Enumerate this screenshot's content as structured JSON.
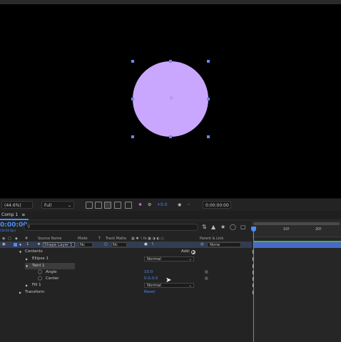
{
  "viewer": {
    "shape_fill": "#caa7ff",
    "handle_color": "#6b86ff"
  },
  "viewer_toolbar": {
    "magnification": "(44.6%)",
    "resolution": "Full",
    "exposure": "+0.0",
    "current_time": "0:00:00:00"
  },
  "timeline_panel": {
    "tab_title": "Comp 1",
    "timecode": "0:00:00",
    "fps_info": "(30.00 fps)",
    "search_placeholder": "",
    "columns": {
      "hash": "#",
      "source_name": "Source Name",
      "mode": "Mode",
      "t": "T",
      "track_matte": "Track Matte",
      "parent": "Parent & Link"
    },
    "layer": {
      "index": "1",
      "name": "Shape Layer 1",
      "mode": "Nc",
      "matte": "Nc",
      "parent": "None"
    },
    "contents_label": "Contents",
    "add_label": "Add:",
    "ellipse_label": "Ellipse 1",
    "ellipse_mode": "Normal",
    "twirl_label": "Twirl 1",
    "angle_label": "Angle",
    "angle_value": "10.0",
    "center_label": "Center",
    "center_value": "0.0,0.0",
    "fill_label": "Fill 1",
    "fill_mode": "Normal",
    "transform_label": "Transform",
    "transform_value": "Reset",
    "ruler": {
      "t0": "0f",
      "t1": "10f",
      "t2": "20f"
    },
    "accent": "#4a8df8"
  }
}
